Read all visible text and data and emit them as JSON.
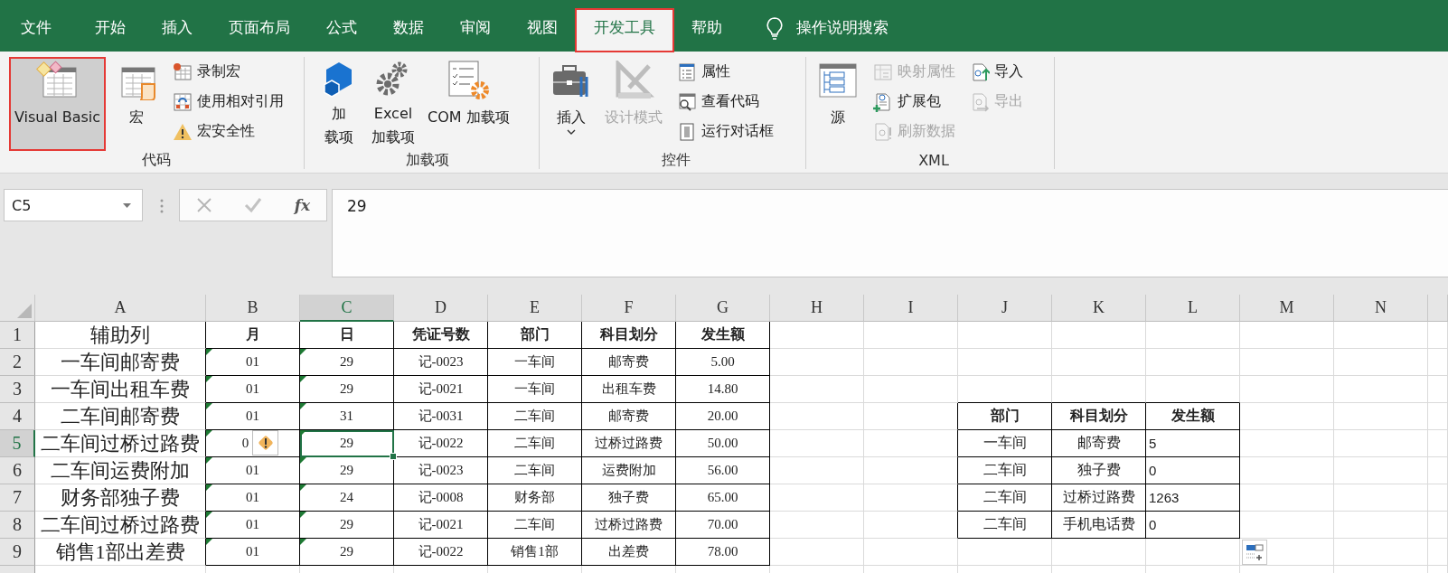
{
  "ribbon_tabs": [
    {
      "label": "文件",
      "selected": false,
      "highlighted": false
    },
    {
      "label": "开始",
      "selected": false,
      "highlighted": false
    },
    {
      "label": "插入",
      "selected": false,
      "highlighted": false
    },
    {
      "label": "页面布局",
      "selected": false,
      "highlighted": false
    },
    {
      "label": "公式",
      "selected": false,
      "highlighted": false
    },
    {
      "label": "数据",
      "selected": false,
      "highlighted": false
    },
    {
      "label": "审阅",
      "selected": false,
      "highlighted": false
    },
    {
      "label": "视图",
      "selected": false,
      "highlighted": false
    },
    {
      "label": "开发工具",
      "selected": true,
      "highlighted": true
    },
    {
      "label": "帮助",
      "selected": false,
      "highlighted": false
    }
  ],
  "tell_me": {
    "label": "操作说明搜索"
  },
  "ribbon_groups": [
    {
      "label": "代码",
      "controls": [
        {
          "kind": "large",
          "lines": [
            "Visual Basic"
          ],
          "hovered": true,
          "highlighted": true,
          "disabled": false,
          "dropdown": false
        },
        {
          "kind": "large",
          "lines": [
            "宏"
          ],
          "hovered": false,
          "highlighted": false,
          "disabled": false,
          "dropdown": false
        },
        {
          "kind": "stack",
          "items": [
            {
              "label": "录制宏",
              "disabled": false
            },
            {
              "label": "使用相对引用",
              "disabled": false
            },
            {
              "label": "宏安全性",
              "disabled": false
            }
          ]
        }
      ]
    },
    {
      "label": "加载项",
      "controls": [
        {
          "kind": "large",
          "lines": [
            "加",
            "载项"
          ],
          "hovered": false,
          "highlighted": false,
          "disabled": false,
          "dropdown": false
        },
        {
          "kind": "large",
          "lines": [
            "Excel",
            "加载项"
          ],
          "hovered": false,
          "highlighted": false,
          "disabled": false,
          "dropdown": false
        },
        {
          "kind": "large",
          "lines": [
            "COM 加载项"
          ],
          "hovered": false,
          "highlighted": false,
          "disabled": false,
          "dropdown": false
        }
      ]
    },
    {
      "label": "控件",
      "controls": [
        {
          "kind": "large",
          "lines": [
            "插入"
          ],
          "hovered": false,
          "highlighted": false,
          "disabled": false,
          "dropdown": true
        },
        {
          "kind": "large",
          "lines": [
            "设计模式"
          ],
          "hovered": false,
          "highlighted": false,
          "disabled": true,
          "dropdown": false
        },
        {
          "kind": "stack",
          "items": [
            {
              "label": "属性",
              "disabled": false
            },
            {
              "label": "查看代码",
              "disabled": false
            },
            {
              "label": "运行对话框",
              "disabled": false
            }
          ]
        }
      ]
    },
    {
      "label": "XML",
      "controls": [
        {
          "kind": "large",
          "lines": [
            "源"
          ],
          "hovered": false,
          "highlighted": false,
          "disabled": false,
          "dropdown": false
        },
        {
          "kind": "stack",
          "items": [
            {
              "label": "映射属性",
              "disabled": true
            },
            {
              "label": "扩展包",
              "disabled": false
            },
            {
              "label": "刷新数据",
              "disabled": true
            }
          ]
        },
        {
          "kind": "stack",
          "items": [
            {
              "label": "导入",
              "disabled": false
            },
            {
              "label": "导出",
              "disabled": true
            }
          ]
        }
      ]
    }
  ],
  "name_box": {
    "value": "C5"
  },
  "formula_bar": {
    "function_label": "fx",
    "value": "29"
  },
  "sheet": {
    "columns": [
      {
        "label": "A",
        "selected": false
      },
      {
        "label": "B",
        "selected": false
      },
      {
        "label": "C",
        "selected": true
      },
      {
        "label": "D",
        "selected": false
      },
      {
        "label": "E",
        "selected": false
      },
      {
        "label": "F",
        "selected": false
      },
      {
        "label": "G",
        "selected": false
      },
      {
        "label": "H",
        "selected": false
      },
      {
        "label": "I",
        "selected": false
      },
      {
        "label": "J",
        "selected": false
      },
      {
        "label": "K",
        "selected": false
      },
      {
        "label": "L",
        "selected": false
      },
      {
        "label": "M",
        "selected": false
      },
      {
        "label": "N",
        "selected": false
      }
    ],
    "rows": [
      {
        "label": "1",
        "selected": false
      },
      {
        "label": "2",
        "selected": false
      },
      {
        "label": "3",
        "selected": false
      },
      {
        "label": "4",
        "selected": false
      },
      {
        "label": "5",
        "selected": true
      },
      {
        "label": "6",
        "selected": false
      },
      {
        "label": "7",
        "selected": false
      },
      {
        "label": "8",
        "selected": false
      },
      {
        "label": "9",
        "selected": false
      }
    ]
  },
  "ledger": {
    "header": [
      "辅助列",
      "月",
      "日",
      "凭证号数",
      "部门",
      "科目划分",
      "发生额"
    ],
    "rows": [
      {
        "cells": [
          "一车间邮寄费",
          "01",
          "29",
          "记-0023",
          "一车间",
          "邮寄费",
          "5.00"
        ],
        "number_as_text": true,
        "warning": false
      },
      {
        "cells": [
          "一车间出租车费",
          "01",
          "29",
          "记-0021",
          "一车间",
          "出租车费",
          "14.80"
        ],
        "number_as_text": true,
        "warning": false
      },
      {
        "cells": [
          "二车间邮寄费",
          "01",
          "31",
          "记-0031",
          "二车间",
          "邮寄费",
          "20.00"
        ],
        "number_as_text": true,
        "warning": false
      },
      {
        "cells": [
          "二车间过桥过路费",
          "0",
          "29",
          "记-0022",
          "二车间",
          "过桥过路费",
          "50.00"
        ],
        "number_as_text": true,
        "warning": true
      },
      {
        "cells": [
          "二车间运费附加",
          "01",
          "29",
          "记-0023",
          "二车间",
          "运费附加",
          "56.00"
        ],
        "number_as_text": true,
        "warning": false
      },
      {
        "cells": [
          "财务部独子费",
          "01",
          "24",
          "记-0008",
          "财务部",
          "独子费",
          "65.00"
        ],
        "number_as_text": true,
        "warning": false
      },
      {
        "cells": [
          "二车间过桥过路费",
          "01",
          "29",
          "记-0021",
          "二车间",
          "过桥过路费",
          "70.00"
        ],
        "number_as_text": true,
        "warning": false
      },
      {
        "cells": [
          "销售1部出差费",
          "01",
          "29",
          "记-0022",
          "销售1部",
          "出差费",
          "78.00"
        ],
        "number_as_text": true,
        "warning": false
      }
    ]
  },
  "summary": {
    "columns": [
      "部门",
      "科目划分",
      "发生额"
    ],
    "rows": [
      [
        "一车间",
        "邮寄费",
        "5"
      ],
      [
        "二车间",
        "独子费",
        "0"
      ],
      [
        "二车间",
        "过桥过路费",
        "1263"
      ],
      [
        "二车间",
        "手机电话费",
        "0"
      ]
    ]
  }
}
